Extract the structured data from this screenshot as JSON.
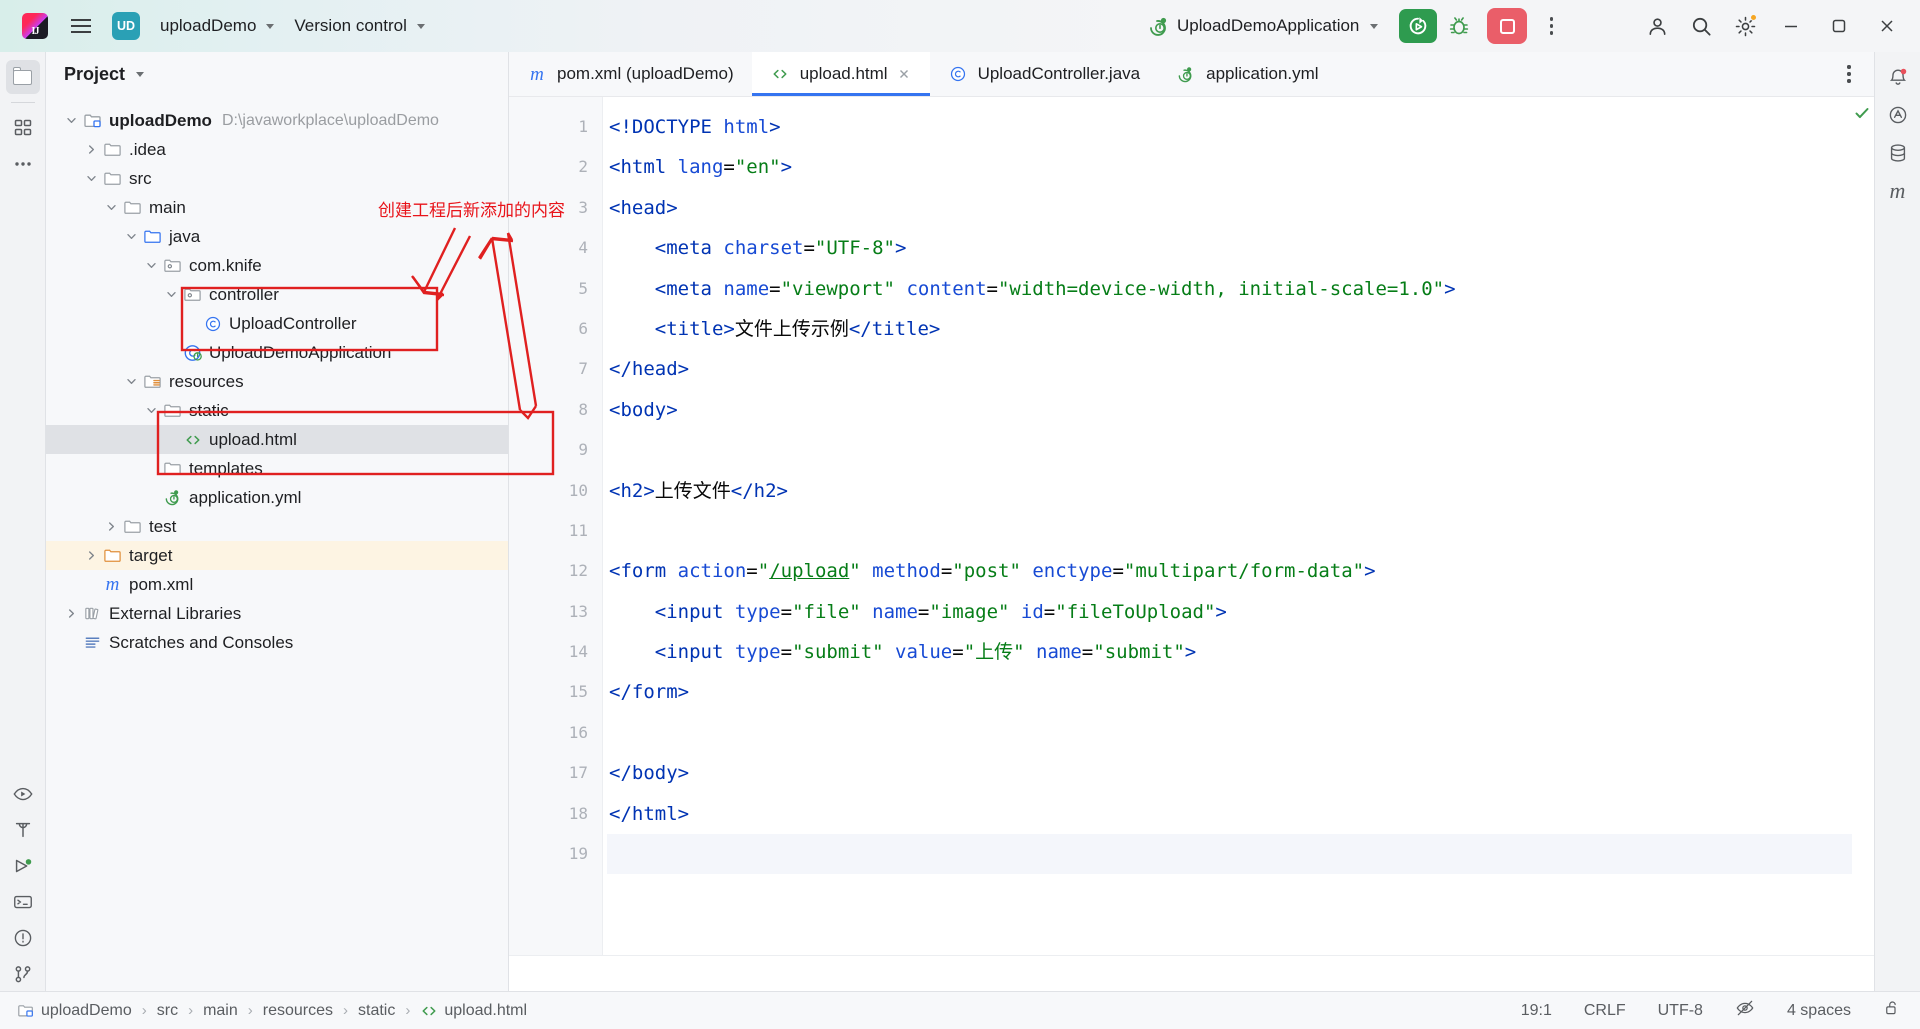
{
  "titlebar": {
    "menu_icon": "hamburger-icon",
    "project_badge": "UD",
    "project_name": "uploadDemo",
    "version_control": "Version control",
    "run_config": "UploadDemoApplication",
    "run_icon": "run-icon",
    "debug_icon": "debug-icon",
    "stop_icon": "stop-icon",
    "more_icon": "more-vertical-icon",
    "account_icon": "account-icon",
    "search_icon": "search-icon",
    "settings_icon": "settings-icon",
    "minimize_icon": "minimize-icon",
    "maximize_icon": "maximize-icon",
    "close_icon": "close-icon"
  },
  "left_toolstrip": [
    {
      "name": "project-tool-icon",
      "glyph": "folder",
      "active": true
    },
    {
      "name": "structure-tool-icon",
      "glyph": "structure"
    },
    {
      "name": "more-tool-icon",
      "glyph": "ellipsis"
    },
    {
      "name": "run-tool-icon",
      "glyph": "run-window"
    },
    {
      "name": "build-tool-icon",
      "glyph": "hammer"
    },
    {
      "name": "services-tool-icon",
      "glyph": "play-badge"
    },
    {
      "name": "terminal-tool-icon",
      "glyph": "terminal"
    },
    {
      "name": "problems-tool-icon",
      "glyph": "warning"
    },
    {
      "name": "git-tool-icon",
      "glyph": "branch"
    }
  ],
  "right_toolstrip": [
    {
      "name": "notifications-icon",
      "glyph": "bell"
    },
    {
      "name": "ai-assistant-icon",
      "glyph": "ai"
    },
    {
      "name": "database-icon",
      "glyph": "db"
    },
    {
      "name": "maven-icon",
      "glyph": "m"
    }
  ],
  "project_panel": {
    "title": "Project",
    "tree": [
      {
        "depth": 0,
        "label": "uploadDemo",
        "path": "D:\\javaworkplace\\uploadDemo",
        "icon": "module-icon",
        "arrow": "down",
        "bold": true
      },
      {
        "depth": 1,
        "label": ".idea",
        "icon": "folder-icon",
        "arrow": "right"
      },
      {
        "depth": 1,
        "label": "src",
        "icon": "folder-icon",
        "arrow": "down"
      },
      {
        "depth": 2,
        "label": "main",
        "icon": "folder-icon",
        "arrow": "down"
      },
      {
        "depth": 3,
        "label": "java",
        "icon": "source-folder-icon",
        "arrow": "down"
      },
      {
        "depth": 4,
        "label": "com.knife",
        "icon": "package-icon",
        "arrow": "down"
      },
      {
        "depth": 5,
        "label": "controller",
        "icon": "package-icon",
        "arrow": "down"
      },
      {
        "depth": 6,
        "label": "UploadController",
        "icon": "java-class-icon",
        "arrow": "none"
      },
      {
        "depth": 5,
        "label": "UploadDemoApplication",
        "icon": "spring-boot-class-icon",
        "arrow": "none"
      },
      {
        "depth": 3,
        "label": "resources",
        "icon": "resource-folder-icon",
        "arrow": "down"
      },
      {
        "depth": 4,
        "label": "static",
        "icon": "folder-icon",
        "arrow": "down"
      },
      {
        "depth": 5,
        "label": "upload.html",
        "icon": "html-file-icon",
        "arrow": "none",
        "selected": true
      },
      {
        "depth": 4,
        "label": "templates",
        "icon": "folder-icon",
        "arrow": "none"
      },
      {
        "depth": 4,
        "label": "application.yml",
        "icon": "spring-yaml-icon",
        "arrow": "none"
      },
      {
        "depth": 2,
        "label": "test",
        "icon": "folder-icon",
        "arrow": "right"
      },
      {
        "depth": 1,
        "label": "target",
        "icon": "folder-excluded-icon",
        "arrow": "right",
        "highlighted": true
      },
      {
        "depth": 1,
        "label": "pom.xml",
        "icon": "maven-file-icon",
        "arrow": "none"
      },
      {
        "depth": 0,
        "label": "External Libraries",
        "icon": "libraries-icon",
        "arrow": "right"
      },
      {
        "depth": 0,
        "label": "Scratches and Consoles",
        "icon": "scratches-icon",
        "arrow": "none"
      }
    ]
  },
  "annotation": {
    "text": "创建工程后新添加的内容",
    "color": "#e02020"
  },
  "tabs": [
    {
      "label": "pom.xml (uploadDemo)",
      "icon": "maven-file-icon",
      "active": false,
      "closable": false
    },
    {
      "label": "upload.html",
      "icon": "html-file-icon",
      "active": true,
      "closable": true
    },
    {
      "label": "UploadController.java",
      "icon": "java-class-icon",
      "active": false,
      "closable": false
    },
    {
      "label": "application.yml",
      "icon": "spring-yaml-icon",
      "active": false,
      "closable": false
    }
  ],
  "editor": {
    "more_icon": "more-vertical-icon",
    "inspection_status": "ok-check-icon",
    "line_numbers": [
      1,
      2,
      3,
      4,
      5,
      6,
      7,
      8,
      9,
      10,
      11,
      12,
      13,
      14,
      15,
      16,
      17,
      18,
      19
    ],
    "cursor_line": 19,
    "lines": [
      {
        "n": 1,
        "tokens": [
          {
            "t": "<!DOCTYPE ",
            "c": "doct"
          },
          {
            "t": "html",
            "c": "at"
          },
          {
            "t": ">",
            "c": "doct"
          }
        ]
      },
      {
        "n": 2,
        "tokens": [
          {
            "t": "<html ",
            "c": "tg"
          },
          {
            "t": "lang",
            "c": "at"
          },
          {
            "t": "=",
            "c": "pl"
          },
          {
            "t": "\"en\"",
            "c": "va"
          },
          {
            "t": ">",
            "c": "tg"
          }
        ]
      },
      {
        "n": 3,
        "tokens": [
          {
            "t": "<head>",
            "c": "tg"
          }
        ]
      },
      {
        "n": 4,
        "tokens": [
          {
            "t": "    <meta ",
            "c": "tg"
          },
          {
            "t": "charset",
            "c": "at"
          },
          {
            "t": "=",
            "c": "pl"
          },
          {
            "t": "\"UTF-8\"",
            "c": "va"
          },
          {
            "t": ">",
            "c": "tg"
          }
        ]
      },
      {
        "n": 5,
        "tokens": [
          {
            "t": "    <meta ",
            "c": "tg"
          },
          {
            "t": "name",
            "c": "at"
          },
          {
            "t": "=",
            "c": "pl"
          },
          {
            "t": "\"viewport\"",
            "c": "va"
          },
          {
            "t": " ",
            "c": "pl"
          },
          {
            "t": "content",
            "c": "at"
          },
          {
            "t": "=",
            "c": "pl"
          },
          {
            "t": "\"width=device-width, initial-scale=1.0\"",
            "c": "va"
          },
          {
            "t": ">",
            "c": "tg"
          }
        ]
      },
      {
        "n": 6,
        "tokens": [
          {
            "t": "    <title>",
            "c": "tg"
          },
          {
            "t": "文件上传示例",
            "c": "pl"
          },
          {
            "t": "</title>",
            "c": "tg"
          }
        ]
      },
      {
        "n": 7,
        "tokens": [
          {
            "t": "</head>",
            "c": "tg"
          }
        ]
      },
      {
        "n": 8,
        "tokens": [
          {
            "t": "<body>",
            "c": "tg"
          }
        ]
      },
      {
        "n": 9,
        "tokens": []
      },
      {
        "n": 10,
        "tokens": [
          {
            "t": "<h2>",
            "c": "tg"
          },
          {
            "t": "上传文件",
            "c": "pl"
          },
          {
            "t": "</h2>",
            "c": "tg"
          }
        ]
      },
      {
        "n": 11,
        "tokens": []
      },
      {
        "n": 12,
        "tokens": [
          {
            "t": "<form ",
            "c": "tg"
          },
          {
            "t": "action",
            "c": "at"
          },
          {
            "t": "=",
            "c": "pl"
          },
          {
            "t": "\"",
            "c": "va"
          },
          {
            "t": "/upload",
            "c": "lnk"
          },
          {
            "t": "\"",
            "c": "va"
          },
          {
            "t": " ",
            "c": "pl"
          },
          {
            "t": "method",
            "c": "at"
          },
          {
            "t": "=",
            "c": "pl"
          },
          {
            "t": "\"post\"",
            "c": "va"
          },
          {
            "t": " ",
            "c": "pl"
          },
          {
            "t": "enctype",
            "c": "at"
          },
          {
            "t": "=",
            "c": "pl"
          },
          {
            "t": "\"multipart/form-data\"",
            "c": "va"
          },
          {
            "t": ">",
            "c": "tg"
          }
        ]
      },
      {
        "n": 13,
        "tokens": [
          {
            "t": "    <input ",
            "c": "tg"
          },
          {
            "t": "type",
            "c": "at"
          },
          {
            "t": "=",
            "c": "pl"
          },
          {
            "t": "\"file\"",
            "c": "va"
          },
          {
            "t": " ",
            "c": "pl"
          },
          {
            "t": "name",
            "c": "at"
          },
          {
            "t": "=",
            "c": "pl"
          },
          {
            "t": "\"image\"",
            "c": "va"
          },
          {
            "t": " ",
            "c": "pl"
          },
          {
            "t": "id",
            "c": "at"
          },
          {
            "t": "=",
            "c": "pl"
          },
          {
            "t": "\"fileToUpload\"",
            "c": "va"
          },
          {
            "t": ">",
            "c": "tg"
          }
        ]
      },
      {
        "n": 14,
        "tokens": [
          {
            "t": "    <input ",
            "c": "tg"
          },
          {
            "t": "type",
            "c": "at"
          },
          {
            "t": "=",
            "c": "pl"
          },
          {
            "t": "\"submit\"",
            "c": "va"
          },
          {
            "t": " ",
            "c": "pl"
          },
          {
            "t": "value",
            "c": "at"
          },
          {
            "t": "=",
            "c": "pl"
          },
          {
            "t": "\"上传\"",
            "c": "va"
          },
          {
            "t": " ",
            "c": "pl"
          },
          {
            "t": "name",
            "c": "at"
          },
          {
            "t": "=",
            "c": "pl"
          },
          {
            "t": "\"submit\"",
            "c": "va"
          },
          {
            "t": ">",
            "c": "tg"
          }
        ]
      },
      {
        "n": 15,
        "tokens": [
          {
            "t": "</form>",
            "c": "tg"
          }
        ]
      },
      {
        "n": 16,
        "tokens": []
      },
      {
        "n": 17,
        "tokens": [
          {
            "t": "</body>",
            "c": "tg"
          }
        ]
      },
      {
        "n": 18,
        "tokens": [
          {
            "t": "</html>",
            "c": "tg"
          }
        ]
      },
      {
        "n": 19,
        "tokens": []
      }
    ]
  },
  "statusbar": {
    "breadcrumbs": [
      {
        "label": "uploadDemo",
        "icon": "module-icon"
      },
      {
        "label": "src",
        "icon": ""
      },
      {
        "label": "main",
        "icon": ""
      },
      {
        "label": "resources",
        "icon": ""
      },
      {
        "label": "static",
        "icon": ""
      },
      {
        "label": "upload.html",
        "icon": "html-file-icon"
      }
    ],
    "caret_position": "19:1",
    "line_separator": "CRLF",
    "encoding": "UTF-8",
    "reader_mode_icon": "reader-mode-off-icon",
    "indent": "4 spaces",
    "lock_icon": "unlocked-icon"
  }
}
